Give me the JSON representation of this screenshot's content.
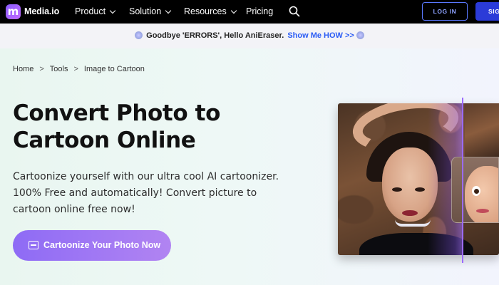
{
  "header": {
    "logo_letter": "m",
    "logo_text": "Media.io",
    "nav": [
      {
        "label": "Product",
        "has_dropdown": true
      },
      {
        "label": "Solution",
        "has_dropdown": true
      },
      {
        "label": "Resources",
        "has_dropdown": true
      },
      {
        "label": "Pricing",
        "has_dropdown": false
      }
    ],
    "search_icon": "search-icon",
    "login_label": "LOG IN",
    "signup_label": "SIG"
  },
  "banner": {
    "message": "Goodbye 'ERRORS', Hello AniEraser.",
    "cta": "Show Me HOW >>"
  },
  "breadcrumb": {
    "items": [
      "Home",
      "Tools",
      "Image to Cartoon"
    ],
    "separator": ">"
  },
  "hero": {
    "title_line1": "Convert Photo to",
    "title_line2": "Cartoon Online",
    "description": "Cartoonize yourself with our ultra cool AI cartoonizer. 100% Free and automatically! Convert picture to cartoon online free now!",
    "cta_label": "Cartoonize Your Photo Now",
    "cta_icon": "image-icon"
  },
  "colors": {
    "nav_bg": "#000000",
    "accent_blue": "#2b5cf5",
    "cta_purple": "#9a74f3",
    "divider_purple": "#9b6bff"
  }
}
